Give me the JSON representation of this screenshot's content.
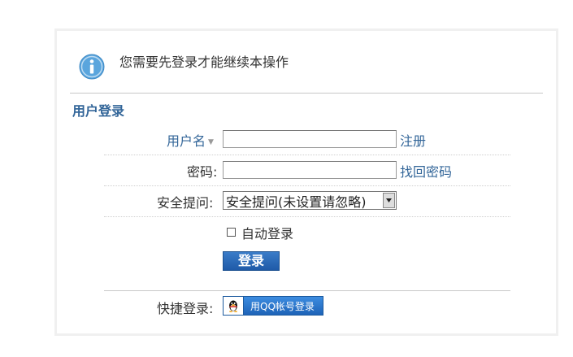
{
  "notice": {
    "text": "您需要先登录才能继续本操作",
    "icon": "info-icon",
    "color": "#5aa5dd"
  },
  "section": {
    "title": "用户登录"
  },
  "form": {
    "username_label": "用户名",
    "username_value": "",
    "register_link": "注册",
    "password_label": "密码:",
    "password_value": "",
    "forgot_link": "找回密码",
    "security_label": "安全提问:",
    "security_selected": "安全提问(未设置请忽略)",
    "remember_label": "自动登录",
    "remember_checked": false,
    "submit_label": "登录"
  },
  "quick_login": {
    "label": "快捷登录:",
    "qq_button_label": "用QQ帐号登录",
    "icon": "qq-penguin-icon"
  },
  "colors": {
    "link": "#336699",
    "button": "#1f5aa8"
  }
}
